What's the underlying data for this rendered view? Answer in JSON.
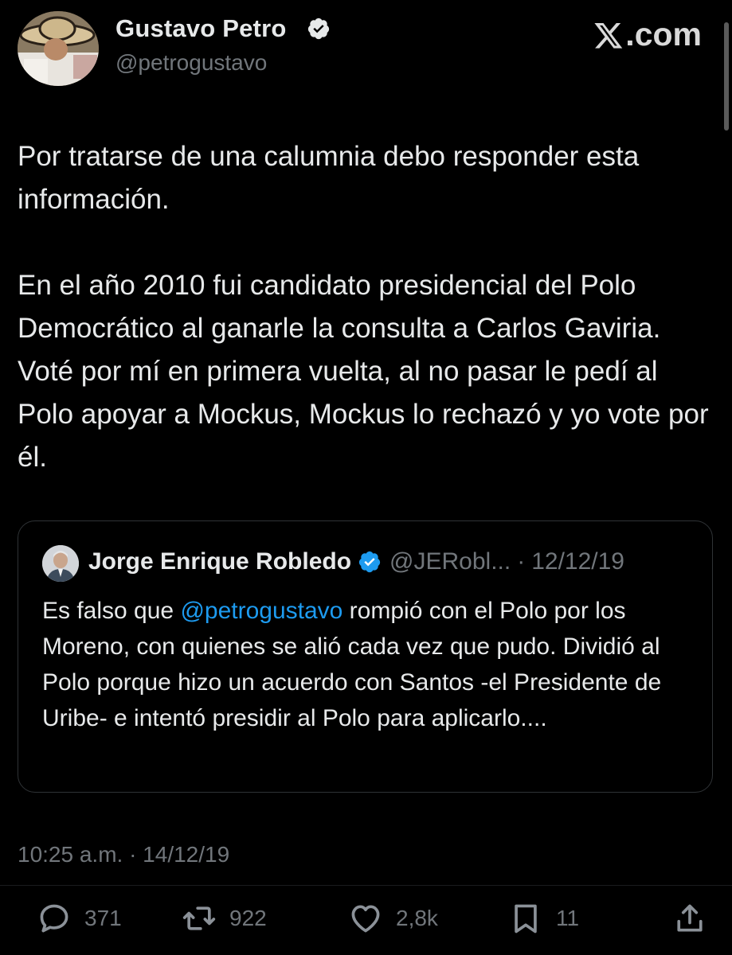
{
  "brand": {
    "label": ".com",
    "logo_icon": "x-logo-icon"
  },
  "author": {
    "name": "Gustavo Petro",
    "handle": "@petrogustavo",
    "verified_icon": "verified-badge-icon",
    "verified_color": "#1d9bf0"
  },
  "tweet": {
    "paragraphs": [
      "Por tratarse de una calumnia debo responder esta información.",
      "En el año 2010 fui candidato presidencial del Polo Democrático al ganarle la consulta a Carlos Gaviria. Voté por mí en primera vuelta, al no pasar le pedí al Polo apoyar a Mockus, Mockus lo rechazó y yo vote por él."
    ],
    "timestamp": "10:25 a.m. · 14/12/19"
  },
  "quote": {
    "name": "Jorge Enrique Robledo",
    "handle": "@JERobl...",
    "separator": "·",
    "date": "12/12/19",
    "text_before": "Es falso que ",
    "mention": "@petrogustavo",
    "text_after": " rompió con el Polo por los Moreno, con quienes se alió cada vez que pudo. Dividió al Polo porque hizo un acuerdo con Santos -el Presidente de Uribe- e intentó presidir al Polo para aplicarlo...."
  },
  "actions": {
    "reply": {
      "icon": "reply-icon",
      "count": "371"
    },
    "retweet": {
      "icon": "retweet-icon",
      "count": "922"
    },
    "like": {
      "icon": "heart-icon",
      "count": "2,8k"
    },
    "bookmark": {
      "icon": "bookmark-icon",
      "count": "11"
    },
    "share": {
      "icon": "share-icon"
    }
  },
  "colors": {
    "background": "#000000",
    "text": "#e7e9ea",
    "secondary": "#71767b",
    "link": "#1d9bf0",
    "border": "#2f3336"
  }
}
